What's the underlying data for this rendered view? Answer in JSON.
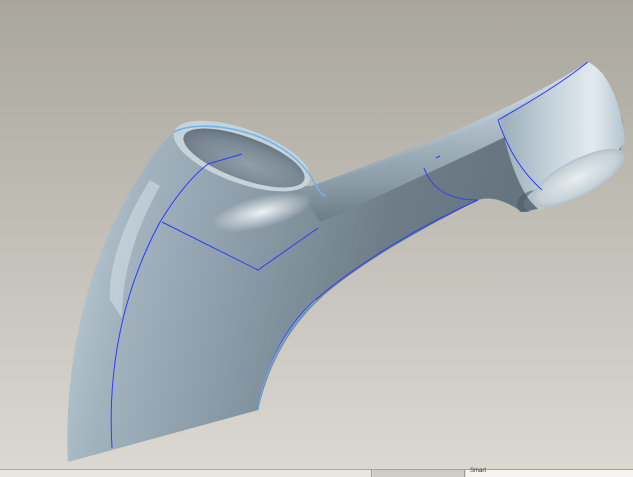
{
  "viewport": {
    "background_top": "#a9a69d",
    "background_bottom": "#dad8d1",
    "model": {
      "surface_color": "#a7b8c3",
      "highlight_color": "#e6eef3",
      "shadow_color": "#6c7b86",
      "edge_color": "#2a3cff",
      "silhouette_color": "#6fb4ea"
    }
  },
  "status_bar": {
    "selection_filter": "Smart"
  }
}
